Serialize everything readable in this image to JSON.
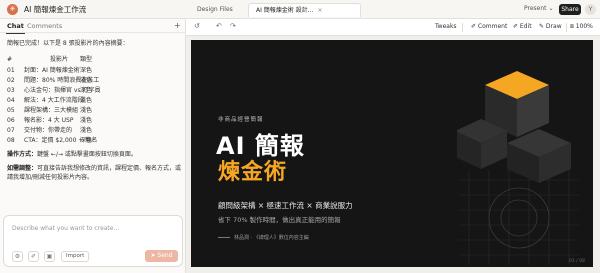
{
  "app": {
    "logo_glyph": "✳",
    "project_title": "AI 簡報煉金工作流",
    "doc_tabs": [
      {
        "label": "Design Files",
        "active": false
      },
      {
        "label": "AI 簡報煉金術 設計...",
        "active": true
      }
    ],
    "present_label": "Present",
    "share_label": "Share",
    "avatar_initial": "Y",
    "accent_color": "#f5a623",
    "brand_color": "#d9704a"
  },
  "chat": {
    "tabs": [
      "Chat",
      "Comments"
    ],
    "new_chat_glyph": "+",
    "intro": "簡報已完成！以下是 8 張投影片的內容摘要：",
    "table_headers": [
      "#",
      "投影片",
      "類型"
    ],
    "table_rows": [
      {
        "num": "01",
        "title": "封面：AI 簡報煉金術",
        "type": "深色"
      },
      {
        "num": "02",
        "title": "問題：80% 時間浪費在苦工",
        "type": "淺色"
      },
      {
        "num": "03",
        "title": "心法金句：指揮官 vs 打字員",
        "type": "深色"
      },
      {
        "num": "04",
        "title": "解法：4 大工作流階段",
        "type": "淺色"
      },
      {
        "num": "05",
        "title": "課程架構：三大模組",
        "type": "淺色"
      },
      {
        "num": "06",
        "title": "報名影：4 大 USP",
        "type": "淺色"
      },
      {
        "num": "07",
        "title": "交付物：你帶走的",
        "type": "淺色"
      },
      {
        "num": "08",
        "title": "CTA：定價 $2,000 + 報名",
        "type": "深色"
      }
    ],
    "ops_label": "操作方式：",
    "ops_text": "鍵盤 ←/→ 或點擊畫面按鈕切換頁面。",
    "adj_label": "如需調整：",
    "adj_text": "可直接告訴我想修改的資訊，課程定價、報名方式，或請我增加/刪減任何投影片內容。",
    "composer": {
      "placeholder": "Describe what you want to create...",
      "settings_icon": "⚙",
      "attach_icon": "✐",
      "image_icon": "▣",
      "import_label": "Import",
      "send_label": "➤ Send"
    }
  },
  "toolbar": {
    "undo_icon": "↺",
    "back_icon": "↶",
    "forward_icon": "↷",
    "tweaks_label": "Tweaks",
    "comment_label": "✐ Comment",
    "edit_label": "✐ Edit",
    "draw_label": "✎ Draw",
    "zoom_label": "⧈ 100%"
  },
  "slide": {
    "kicker": "非商品經營簡報",
    "title_line1": "AI 簡報",
    "title_line2": "煉金術",
    "subtitle": "顧問級架構 × 極速工作流 × 商業說服力",
    "tagline": "省下 70% 製作時間，做出真正能用的簡報",
    "credit": "林品潤 · 《總理人》數位內容主編",
    "page_number": "01 / 08",
    "bg_color": "#151515",
    "gold_color": "#f5a623"
  }
}
